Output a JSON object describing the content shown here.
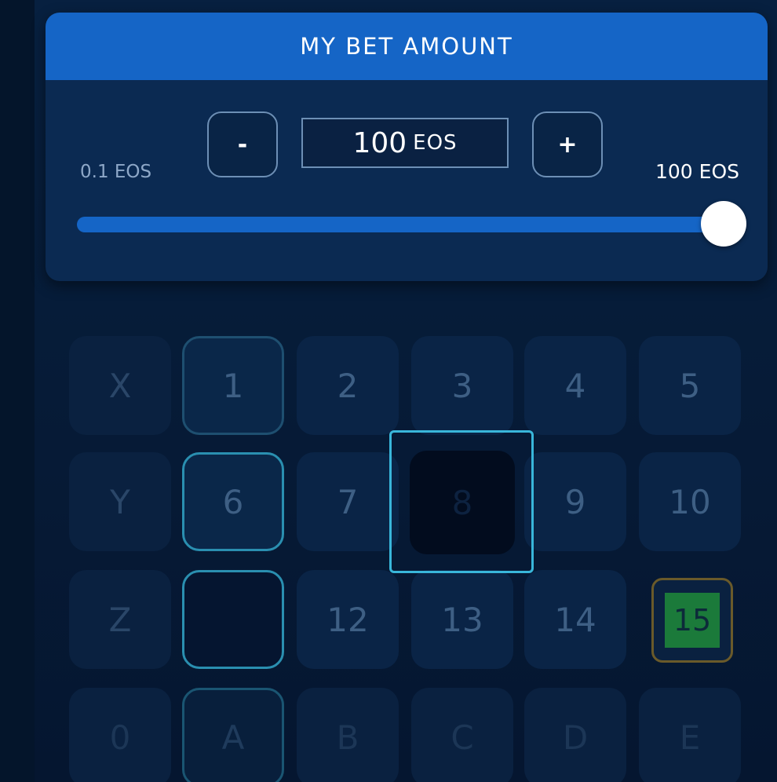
{
  "bet": {
    "title": "MY BET AMOUNT",
    "minus_label": "-",
    "plus_label": "+",
    "amount_value": "100",
    "amount_unit": "EOS",
    "min_label": "0.1 EOS",
    "max_label": "100 EOS",
    "slider_level": 1.0
  },
  "grid": {
    "row1": [
      "X",
      "1",
      "2",
      "3",
      "4",
      "5"
    ],
    "row2": [
      "Y",
      "6",
      "7",
      "8",
      "9",
      "10"
    ],
    "row3": [
      "Z",
      "",
      "12",
      "13",
      "14",
      "15"
    ],
    "row4": [
      "0",
      "A",
      "B",
      "C",
      "D",
      "E"
    ]
  },
  "colors": {
    "accent": "#1565c6",
    "panel": "#0b2a52",
    "background": "#061b37",
    "highlight_border": "#39b6da",
    "win_cell": "#1b7a3a"
  }
}
